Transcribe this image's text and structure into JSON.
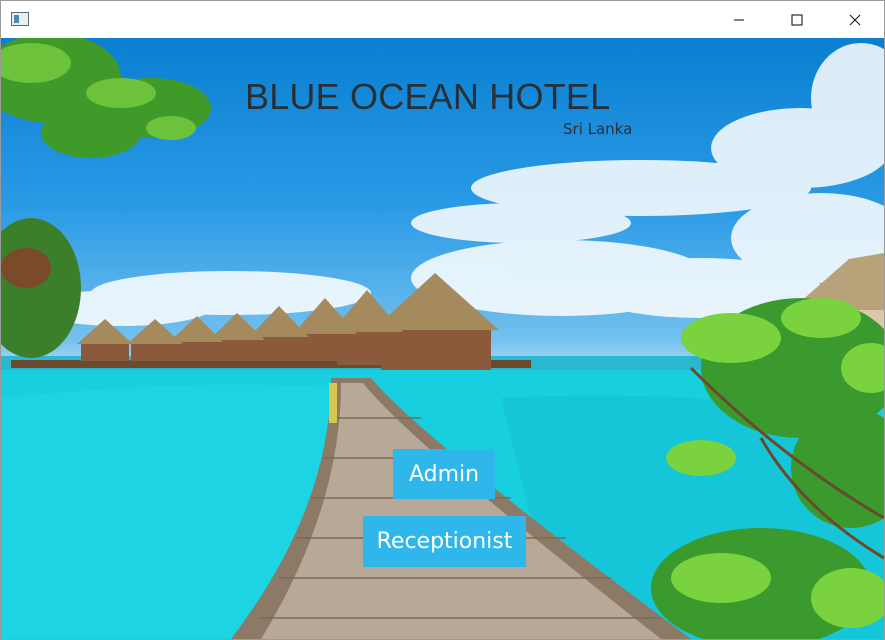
{
  "window": {
    "controls": {
      "minimize_icon": "minimize-icon",
      "maximize_icon": "maximize-icon",
      "close_icon": "close-icon"
    }
  },
  "header": {
    "title": "BLUE OCEAN HOTEL",
    "subtitle": "Sri Lanka"
  },
  "actions": {
    "admin_label": "Admin",
    "receptionist_label": "Receptionist"
  },
  "colors": {
    "button_bg": "#2fb6ea",
    "button_text": "#ffffff",
    "title_text": "#2a2f35"
  }
}
